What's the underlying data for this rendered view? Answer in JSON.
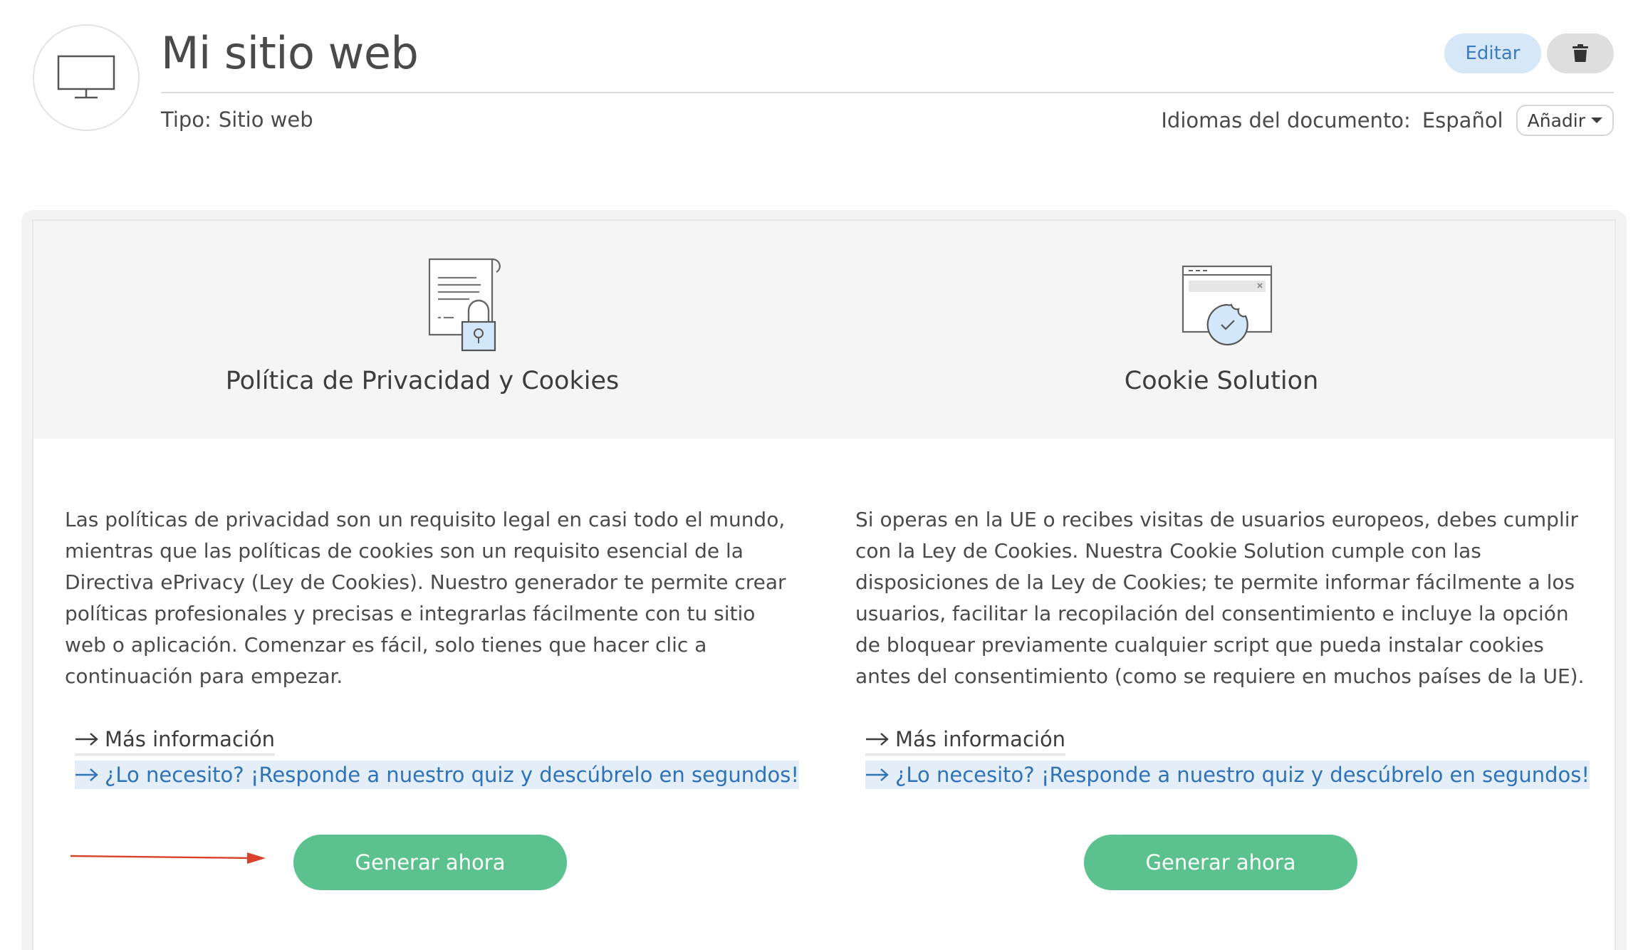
{
  "header": {
    "site_title": "Mi sitio web",
    "type_label": "Tipo:",
    "type_value": "Sitio web",
    "edit_label": "Editar",
    "delete_icon": "trash-icon",
    "languages_label": "Idiomas del documento:",
    "language_value": "Español",
    "add_label": "Añadir",
    "avatar_icon": "monitor-icon"
  },
  "products": [
    {
      "icon": "document-lock-icon",
      "title": "Política de Privacidad y Cookies",
      "description": "Las políticas de privacidad son un requisito legal en casi todo el mundo, mientras que las políticas de cookies son un requisito esencial de la Directiva ePrivacy (Ley de Cookies). Nuestro generador te permite crear políticas profesionales y precisas e integrarlas fácilmente con tu sitio web o aplicación. Comenzar es fácil, solo tienes que hacer clic a continuación para empezar.",
      "more_info": "Más información",
      "quiz": "¿Lo necesito? ¡Responde a nuestro quiz y descúbrelo en segundos!",
      "button": "Generar ahora"
    },
    {
      "icon": "cookie-banner-icon",
      "title": "Cookie Solution",
      "description": "Si operas en la UE o recibes visitas de usuarios europeos, debes cumplir con la Ley de Cookies. Nuestra Cookie Solution cumple con las disposiciones de la Ley de Cookies; te permite informar fácilmente a los usuarios, facilitar la recopilación del consentimiento e incluye la opción de bloquear previamente cualquier script que pueda instalar cookies antes del consentimiento (como se requiere en muchos países de la UE).",
      "more_info": "Más información",
      "quiz": "¿Lo necesito? ¡Responde a nuestro quiz y descúbrelo en segundos!",
      "button": "Generar ahora"
    }
  ],
  "colors": {
    "primary_green": "#5bc28f",
    "link_blue": "#2f72b8",
    "edit_bg": "#d6e8f8",
    "annotation_red": "#d9412b"
  }
}
